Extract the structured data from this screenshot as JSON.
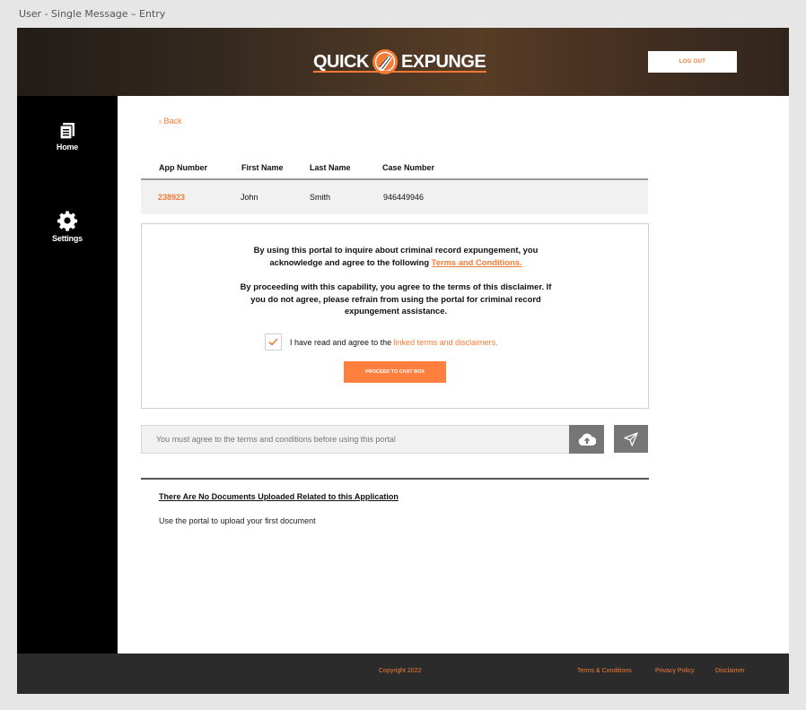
{
  "page_label": "User - Single Message – Entry",
  "header": {
    "logo_left": "QUICK",
    "logo_right": "EXPUNGE",
    "logout_label": "LOG OUT"
  },
  "sidebar": {
    "items": [
      {
        "label": "Home",
        "icon": "document-icon"
      },
      {
        "label": "Settings",
        "icon": "gear-icon"
      }
    ]
  },
  "back_label": "‹ Back",
  "application": {
    "headers": [
      "App Number",
      "First Name",
      "Last Name",
      "Case Number"
    ],
    "row": [
      "238923",
      "John",
      "Smith",
      "946449946"
    ]
  },
  "terms": {
    "paragraph1_text": "By using this portal to inquire about criminal record expungement, you acknowledge and agree to the following ",
    "paragraph1_link": "Terms and Conditions.",
    "paragraph2": "By proceeding with this capability, you agree to the terms of this disclaimer. If you do not agree, please refrain from using the portal for criminal record expungement assistance.",
    "agree_text": "I have read and agree to the ",
    "agree_link": "linked terms and disclaimers.",
    "checked": true,
    "proceed_label": "PROCEED TO CHAT BOX"
  },
  "message": {
    "placeholder": "You must agree to the terms and conditions before using this portal"
  },
  "documents": {
    "title": "There Are No Documents Uploaded Related to this Application",
    "subtitle": "Use the portal to upload your first document"
  },
  "footer": {
    "copyright": "Copyright 2022",
    "links": [
      "Terms & Conditions",
      "Privacy Policy",
      "Disclaimer"
    ]
  },
  "colors": {
    "accent": "#f47a35",
    "sidebar": "#000000",
    "footer": "#2b2b2b",
    "button_gray": "#767676"
  }
}
